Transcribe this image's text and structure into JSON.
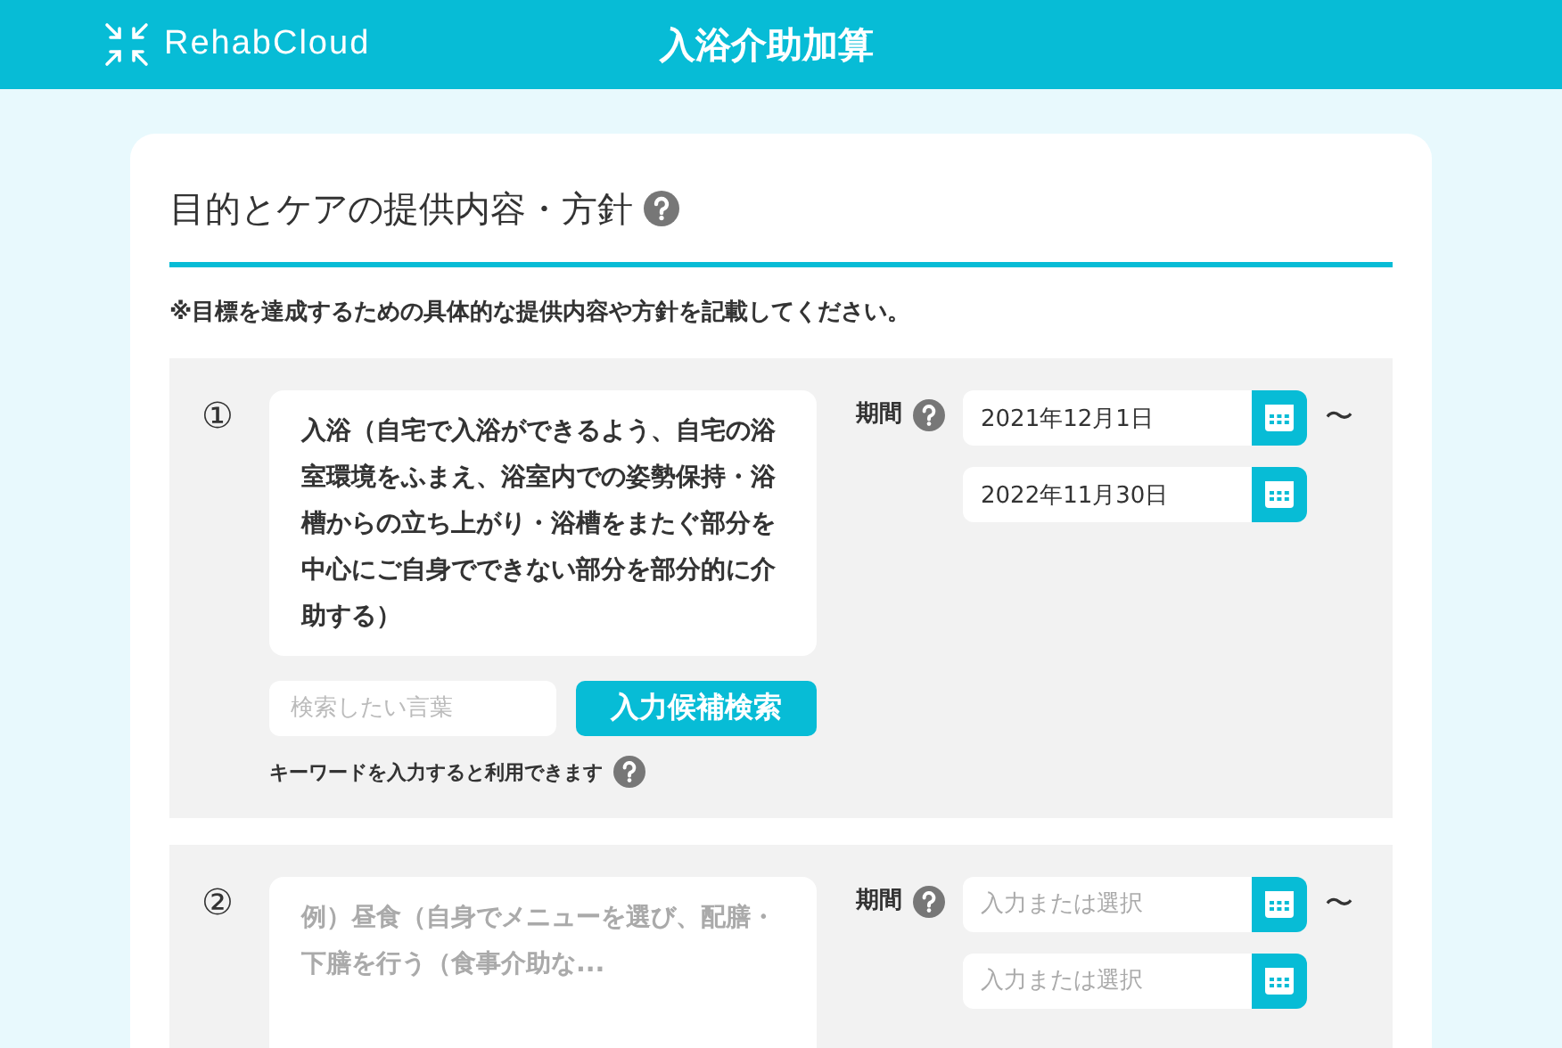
{
  "header": {
    "logo": "RehabCloud",
    "title": "入浴介助加算"
  },
  "section": {
    "title": "目的とケアの提供内容・方針",
    "note": "※目標を達成するための具体的な提供内容や方針を記載してください。"
  },
  "entries": [
    {
      "number": "①",
      "content": {
        "value": "入浴（自宅で入浴ができるよう、自宅の浴室環境をふまえ、浴室内での姿勢保持・浴槽からの立ち上がり・浴槽をまたぐ部分を中心にご自身でできない部分を部分的に介助する）"
      },
      "search": {
        "placeholder": "検索したい言葉",
        "button": "入力候補検索",
        "hint": "キーワードを入力すると利用できます"
      },
      "period": {
        "label": "期間",
        "start": {
          "value": "2021年12月1日"
        },
        "end": {
          "value": "2022年11月30日"
        },
        "separator": "〜"
      }
    },
    {
      "number": "②",
      "content": {
        "placeholder": "例）昼食（自身でメニューを選び、配膳・下膳を行う（食事介助な..."
      },
      "period": {
        "label": "期間",
        "start": {
          "placeholder": "入力または選択"
        },
        "end": {
          "placeholder": "入力または選択"
        },
        "separator": "〜"
      }
    }
  ]
}
